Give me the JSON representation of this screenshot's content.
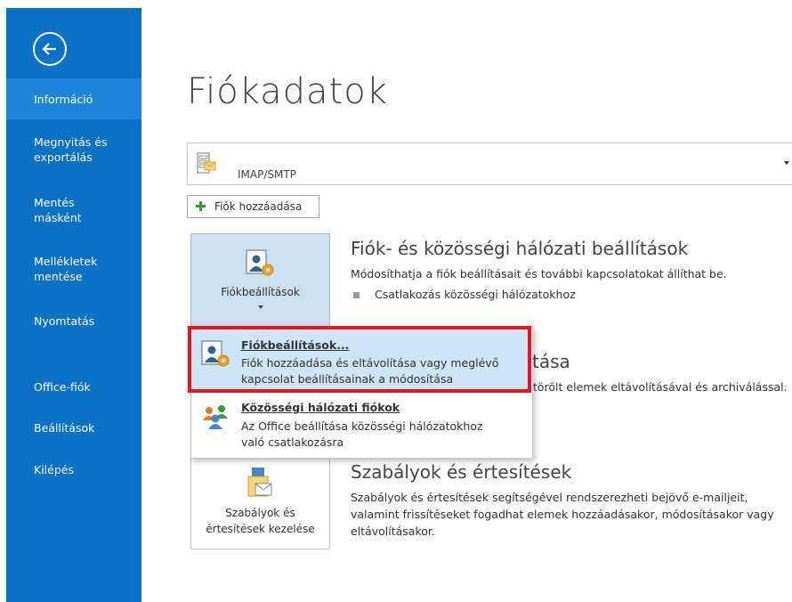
{
  "sidebar": {
    "items": [
      {
        "label": "Információ"
      },
      {
        "label": "Megnyitás és exportálás"
      },
      {
        "label": "Mentés másként"
      },
      {
        "label": "Mellékletek mentése"
      },
      {
        "label": "Nyomtatás"
      },
      {
        "label": "Office-fiók"
      },
      {
        "label": "Beállítások"
      },
      {
        "label": "Kilépés"
      }
    ]
  },
  "main": {
    "title": "Fiókadatok",
    "account": {
      "label": "IMAP/SMTP"
    },
    "add_account_label": "Fiók hozzáadása",
    "account_settings": {
      "tile_label": "Fiókbeállítások",
      "heading": "Fiók- és közösségi hálózati beállítások",
      "description": "Módosíthatja a fiók beállításait és további kapcsolatokat állíthat be.",
      "bullet": "Csatlakozás közösségi hálózatokhoz"
    },
    "mailbox_fragment": {
      "heading_fragment": "tása",
      "text_fragment": "törölt elemek eltávolításával és archiválással."
    },
    "rules": {
      "tile_label_line1": "Szabályok és",
      "tile_label_line2": "értesítések kezelése",
      "heading": "Szabályok és értesítések",
      "desc_line1": "Szabályok és értesítések segítségével rendszerezheti bejövő e-mailjeit,",
      "desc_line2": "valamint frissítéseket fogadhat elemek hozzáadásakor, módosításakor vagy",
      "desc_line3": "eltávolításakor."
    }
  },
  "menu": {
    "items": [
      {
        "title": "Fiókbeállítások...",
        "desc_line1": "Fiók hozzáadása és eltávolítása vagy meglévő",
        "desc_line2": "kapcsolat beállításainak a módosítása"
      },
      {
        "title": "Közösségi hálózati fiókok",
        "desc_line1": "Az Office beállítása közösségi hálózatokhoz",
        "desc_line2": "való csatlakozásra"
      }
    ]
  },
  "colors": {
    "sidebar": "#0a72c6",
    "sidebar_active": "#1c87d8",
    "highlight": "#cfe4f5",
    "callout": "#e2161d"
  }
}
